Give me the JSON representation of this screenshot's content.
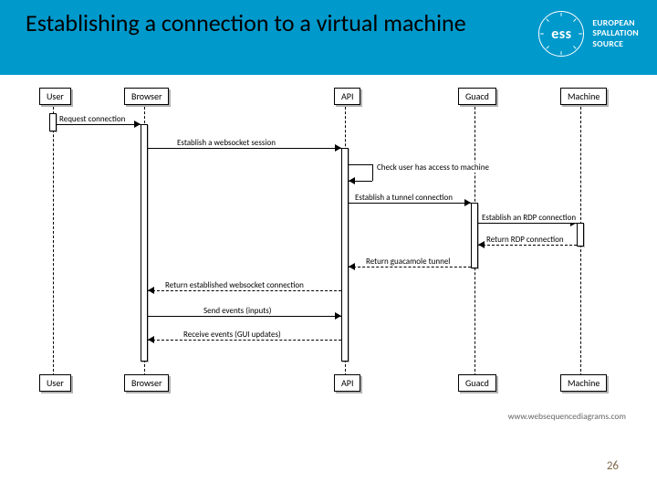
{
  "header": {
    "title": "Establishing a connection to a virtual machine",
    "logo_text_line1": "EUROPEAN",
    "logo_text_line2": "SPALLATION",
    "logo_text_line3": "SOURCE",
    "logo_inner": "ess"
  },
  "actors": {
    "user": "User",
    "browser": "Browser",
    "api": "API",
    "guacd": "Guacd",
    "machine": "Machine"
  },
  "messages": {
    "m1": "Request connection",
    "m2": "Establish a websocket session",
    "m3": "Check user has access to machine",
    "m4": "Establish a tunnel connection",
    "m5": "Establish an RDP connection",
    "m6": "Return RDP connection",
    "m7": "Return guacamole tunnel",
    "m8": "Return established websocket connection",
    "m9": "Send events (inputs)",
    "m10": "Receive events (GUI updates)"
  },
  "footer": {
    "watermark": "www.websequencediagrams.com",
    "page": "26"
  }
}
